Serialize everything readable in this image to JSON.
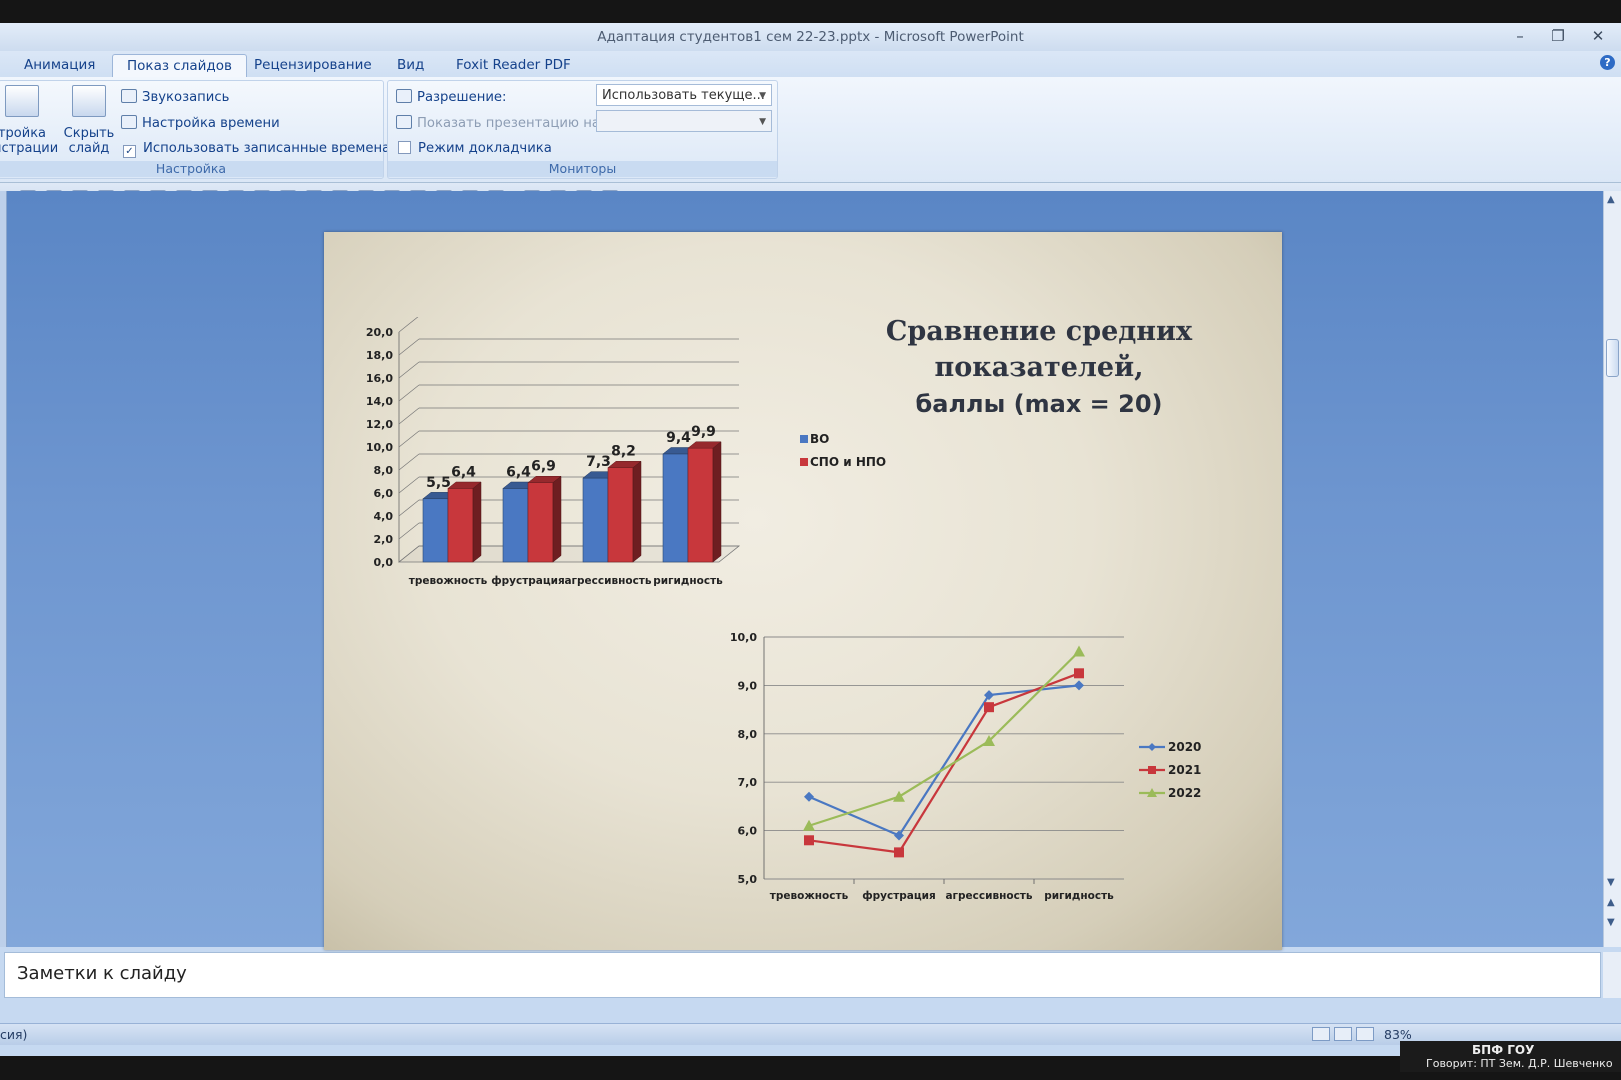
{
  "window": {
    "title": "Адаптация студентов1 сем 22-23.pptx - Microsoft PowerPoint",
    "controls": {
      "minimize": "–",
      "restore": "❐",
      "close": "✕"
    }
  },
  "tabs": [
    "Анимация",
    "Показ слайдов",
    "Рецензирование",
    "Вид",
    "Foxit Reader PDF"
  ],
  "active_tab": "Показ слайдов",
  "ribbon": {
    "setup_group": {
      "setup_btn": [
        "тройка",
        "нстрации"
      ],
      "hide_btn": [
        "Скрыть",
        "слайд"
      ],
      "record": "Звукозапись",
      "timing": "Настройка времени",
      "use_timings": "Использовать записанные времена",
      "use_timings_checked": true,
      "label": "Настройка"
    },
    "monitors_group": {
      "resolution_label": "Разрешение:",
      "resolution_value": "Использовать текуще...",
      "show_on_label": "Показать презентацию на:",
      "presenter_view": "Режим докладчика",
      "presenter_checked": false,
      "label": "Мониторы"
    }
  },
  "slide": {
    "title": [
      "Сравнение средних",
      "показателей,",
      "баллы  (max = 20)"
    ]
  },
  "chart_data": [
    {
      "type": "bar",
      "categories": [
        "тревожность",
        "фрустрация",
        "агрессивность",
        "ригидность"
      ],
      "series": [
        {
          "name": "ВО",
          "color": "#4a78c2",
          "values": [
            5.5,
            6.4,
            7.3,
            9.4
          ]
        },
        {
          "name": "СПО и НПО",
          "color": "#c8373c",
          "values": [
            6.4,
            6.9,
            8.2,
            9.9
          ]
        }
      ],
      "ylim": [
        0,
        20
      ],
      "yticks": [
        "0,0",
        "2,0",
        "4,0",
        "6,0",
        "8,0",
        "10,0",
        "12,0",
        "14,0",
        "16,0",
        "18,0",
        "20,0"
      ],
      "data_labels": [
        [
          "5,5",
          "6,4",
          "7,3",
          "9,4"
        ],
        [
          "6,4",
          "6,9",
          "8,2",
          "9,9"
        ]
      ],
      "grid": true,
      "legend": "right"
    },
    {
      "type": "line",
      "categories": [
        "тревожность",
        "фрустрация",
        "агрессивность",
        "ригидность"
      ],
      "series": [
        {
          "name": "2020",
          "color": "#4a78c2",
          "values": [
            6.7,
            5.9,
            8.8,
            9.0
          ]
        },
        {
          "name": "2021",
          "color": "#c8373c",
          "values": [
            5.8,
            5.55,
            8.55,
            9.25
          ]
        },
        {
          "name": "2022",
          "color": "#9bbb59",
          "values": [
            6.1,
            6.7,
            7.85,
            9.7
          ]
        }
      ],
      "ylim": [
        5,
        10
      ],
      "yticks": [
        "5,0",
        "6,0",
        "7,0",
        "8,0",
        "9,0",
        "10,0"
      ],
      "grid": true,
      "legend": "right"
    }
  ],
  "notes_placeholder": "Заметки к слайду",
  "status": {
    "left_text": "сия)",
    "zoom": "83%"
  },
  "overlay": {
    "line1": "БПФ ГОУ",
    "line2": "Говорит: ПТ Зем. Д.Р. Шевченко"
  }
}
